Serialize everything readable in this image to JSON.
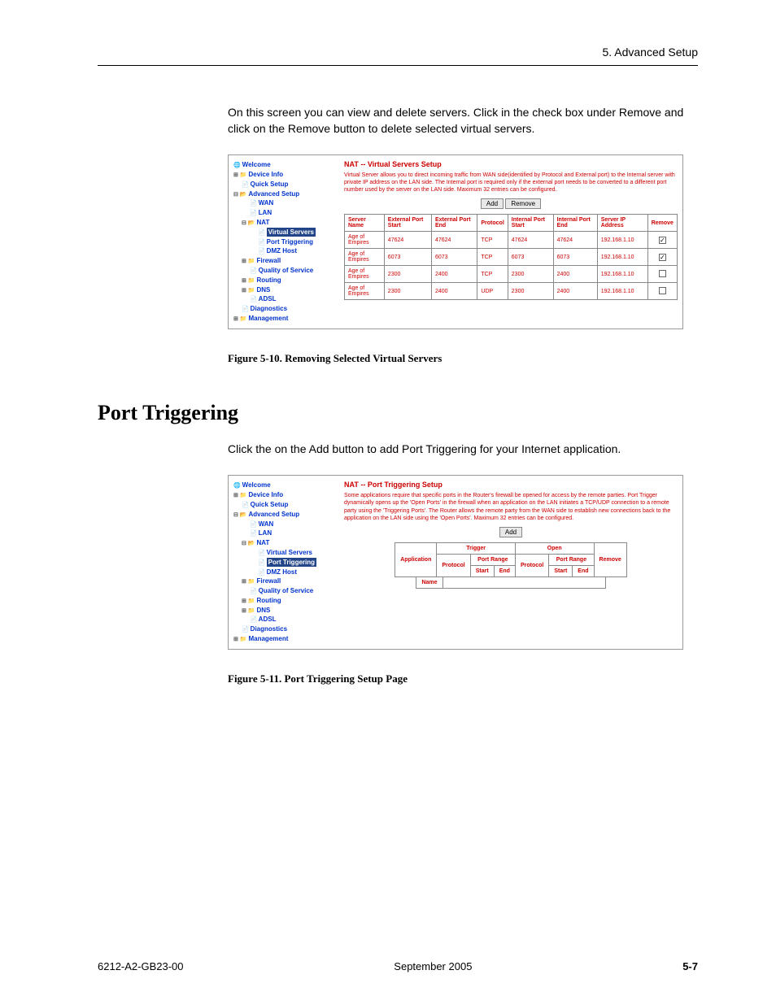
{
  "header": {
    "section": "5. Advanced Setup"
  },
  "para1": "On this screen you can view and delete servers. Click in the check box under Remove and click on the Remove button to delete selected virtual servers.",
  "fig1_caption": "Figure 5-10.    Removing Selected Virtual Servers",
  "heading": "Port Triggering",
  "para2": "Click the on the Add button to add Port Triggering for your Internet application.",
  "fig2_caption": "Figure 5-11.    Port Triggering Setup Page",
  "footer": {
    "left": "6212-A2-GB23-00",
    "center": "September 2005",
    "right": "5-7"
  },
  "tree": {
    "welcome": "Welcome",
    "device_info": "Device Info",
    "quick_setup": "Quick Setup",
    "advanced_setup": "Advanced Setup",
    "wan": "WAN",
    "lan": "LAN",
    "nat": "NAT",
    "virtual_servers": "Virtual Servers",
    "port_triggering": "Port Triggering",
    "dmz_host": "DMZ Host",
    "firewall": "Firewall",
    "qos": "Quality of Service",
    "routing": "Routing",
    "dns": "DNS",
    "adsl": "ADSL",
    "diagnostics": "Diagnostics",
    "management": "Management"
  },
  "vs": {
    "title": "NAT -- Virtual Servers Setup",
    "desc": "Virtual Server allows you to direct incoming traffic from WAN side(identified by Protocol and External port) to the Internal server with private IP address on the LAN side. The Internal port is required only if the external port needs to be converted to a different port number used by the server on the LAN side. Maximum 32 entries can be configured.",
    "add_btn": "Add",
    "remove_btn": "Remove",
    "cols": {
      "c1": "Server Name",
      "c2": "External Port Start",
      "c3": "External Port End",
      "c4": "Protocol",
      "c5": "Internal Port Start",
      "c6": "Internal Port End",
      "c7": "Server IP Address",
      "c8": "Remove"
    },
    "rows": [
      {
        "name": "Age of Empires",
        "eps": "47624",
        "epe": "47624",
        "proto": "TCP",
        "ips": "47624",
        "ipe": "47624",
        "ip": "192.168.1.10",
        "chk": true
      },
      {
        "name": "Age of Empires",
        "eps": "6073",
        "epe": "6073",
        "proto": "TCP",
        "ips": "6073",
        "ipe": "6073",
        "ip": "192.168.1.10",
        "chk": true
      },
      {
        "name": "Age of Empires",
        "eps": "2300",
        "epe": "2400",
        "proto": "TCP",
        "ips": "2300",
        "ipe": "2400",
        "ip": "192.168.1.10",
        "chk": false
      },
      {
        "name": "Age of Empires",
        "eps": "2300",
        "epe": "2400",
        "proto": "UDP",
        "ips": "2300",
        "ipe": "2400",
        "ip": "192.168.1.10",
        "chk": false
      }
    ]
  },
  "pt": {
    "title": "NAT -- Port Triggering Setup",
    "desc": "Some applications require that specific ports in the Router's firewall be opened for access by the remote parties. Port Trigger dynamically opens up the 'Open Ports' in the firewall when an application on the LAN initiates a TCP/UDP connection to a remote party using the 'Triggering Ports'. The Router allows the remote party from the WAN side to establish new connections back to the application on the LAN side using the 'Open Ports'. Maximum 32 entries can be configured.",
    "add_btn": "Add",
    "cols": {
      "app": "Application",
      "trigger": "Trigger",
      "open": "Open",
      "remove": "Remove",
      "name": "Name",
      "protocol": "Protocol",
      "port_range": "Port Range",
      "start": "Start",
      "end": "End"
    }
  }
}
